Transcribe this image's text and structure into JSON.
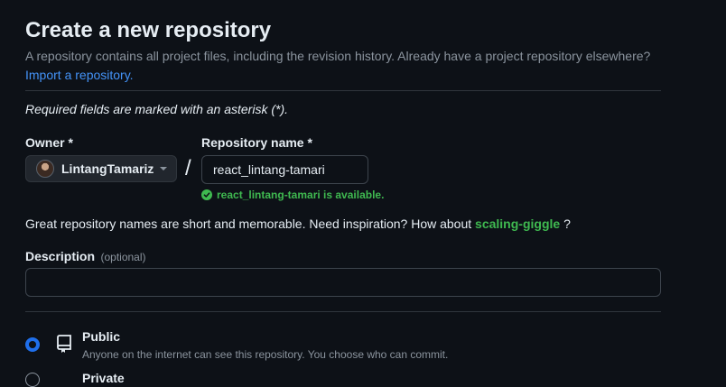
{
  "header": {
    "title": "Create a new repository",
    "subtitle": "A repository contains all project files, including the revision history. Already have a project repository elsewhere?",
    "import_link": "Import a repository."
  },
  "form": {
    "required_note": "Required fields are marked with an asterisk (*).",
    "owner": {
      "label": "Owner *",
      "value": "LintangTamariz"
    },
    "repo_name": {
      "label": "Repository name *",
      "value": "react_lintang-tamari",
      "availability": "react_lintang-tamari is available."
    },
    "separator": "/",
    "inspiration": {
      "text": "Great repository names are short and memorable. Need inspiration? How about",
      "suggestion": "scaling-giggle",
      "suffix": "?"
    },
    "description": {
      "label": "Description",
      "optional": "(optional)",
      "value": ""
    },
    "visibility": {
      "public": {
        "title": "Public",
        "description": "Anyone on the internet can see this repository. You choose who can commit.",
        "selected": true
      },
      "private": {
        "title": "Private",
        "selected": false
      }
    }
  },
  "colors": {
    "background": "#0d1117",
    "link": "#4493f8",
    "success": "#3fb950",
    "accent": "#1f6feb"
  },
  "icons": [
    "check-circle-icon",
    "repo-icon",
    "caret-down-icon"
  ]
}
